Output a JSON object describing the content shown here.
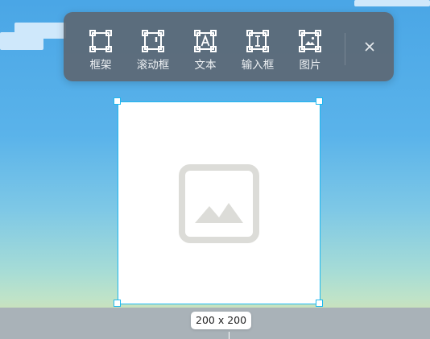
{
  "toolbar": {
    "tools": [
      {
        "label": "框架",
        "icon": "frame-icon"
      },
      {
        "label": "滚动框",
        "icon": "scroll-frame-icon"
      },
      {
        "label": "文本",
        "icon": "text-icon"
      },
      {
        "label": "输入框",
        "icon": "input-icon"
      },
      {
        "label": "图片",
        "icon": "image-icon"
      }
    ],
    "close_icon": "close-icon"
  },
  "canvas": {
    "selected_element": {
      "type": "image-placeholder",
      "size_label": "200 x 200",
      "icon": "image-placeholder-icon"
    }
  },
  "colors": {
    "toolbar_bg": "#5c6874",
    "selection": "#1eb8f0",
    "placeholder_icon": "#dcdcd8"
  }
}
